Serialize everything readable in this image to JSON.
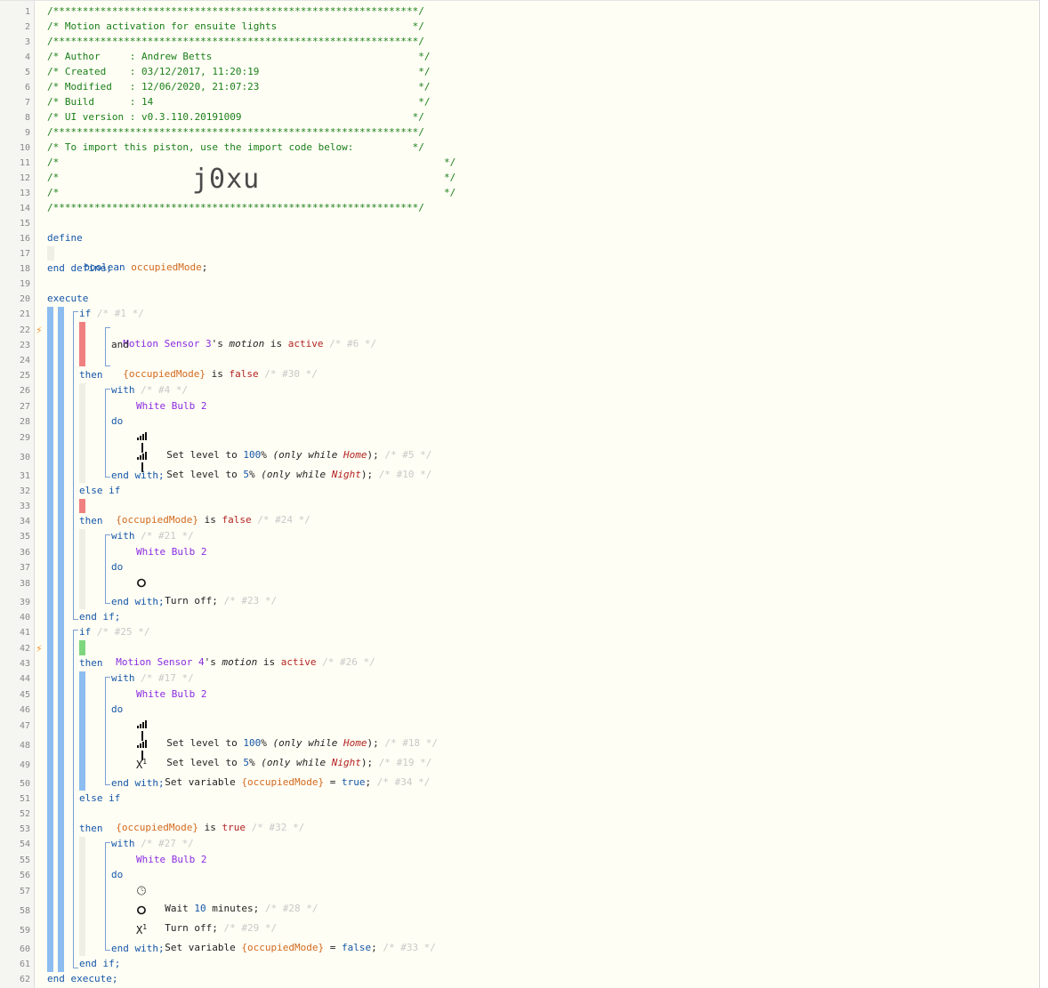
{
  "gutter": {
    "line_numbers": [
      "1",
      "2",
      "3",
      "4",
      "5",
      "6",
      "7",
      "8",
      "9",
      "10",
      "11",
      "12",
      "13",
      "14",
      "15",
      "16",
      "17",
      "18",
      "19",
      "20",
      "21",
      "22",
      "23",
      "24",
      "25",
      "26",
      "27",
      "28",
      "29",
      "30",
      "31",
      "32",
      "33",
      "34",
      "35",
      "36",
      "37",
      "38",
      "39",
      "40",
      "41",
      "42",
      "43",
      "44",
      "45",
      "46",
      "47",
      "48",
      "49",
      "50",
      "51",
      "52",
      "53",
      "54",
      "55",
      "56",
      "57",
      "58",
      "59",
      "60",
      "61",
      "62"
    ],
    "trigger_icon": "lightning-icon"
  },
  "header": {
    "stars": "/**************************************************************/",
    "stars_short": "/**************************************************************/",
    "title": "/* Motion activation for ensuite lights                       */",
    "author": "/* Author     : Andrew Betts                                   */",
    "created": "/* Created    : 03/12/2017, 11:20:19                           */",
    "modified": "/* Modified   : 12/06/2020, 21:07:23                           */",
    "build": "/* Build      : 14                                             */",
    "ui_version": "/* UI version : v0.3.110.20191009                             */",
    "import_note": "/* To import this piston, use the import code below:          */",
    "empty_left": "/*",
    "empty_right": "*/",
    "import_code": "j0xu"
  },
  "code": {
    "define": "define",
    "boolean": "boolean",
    "occupied_mode": "occupiedMode",
    "semicolon": ";",
    "end_define": "end define;",
    "execute": "execute",
    "end_execute": "end execute;",
    "if": "if",
    "then": "then",
    "else_if": "else if",
    "end_if": "end if;",
    "with": "with",
    "do": "do",
    "end_with": "end with;",
    "and": "and",
    "is": "is",
    "is_false": "is",
    "false": "false",
    "true": "true",
    "active": "active",
    "motion": "motion",
    "s_motion_3": "'s",
    "s_motion_4": "'s",
    "motion_sensor_3": "Motion Sensor 3",
    "motion_sensor_4": "Motion Sensor 4",
    "white_bulb": "White Bulb 2",
    "occupied_var": "{occupiedMode}",
    "set_level": "Set level to",
    "pct_100": "100",
    "pct_5": "5",
    "pct_sign": "%",
    "only_while_open": "(only while",
    "home": "Home",
    "night": "Night",
    "close_paren": ");",
    "turn_off": "Turn off;",
    "set_variable": "Set variable",
    "equals": "=",
    "wait": "Wait",
    "ten": "10",
    "minutes": "minutes;",
    "c1": "/* #1 */",
    "c6": "/* #6 */",
    "c30": "/* #30 */",
    "c4": "/* #4 */",
    "c5": "/* #5 */",
    "c10": "/* #10 */",
    "c24": "/* #24 */",
    "c21": "/* #21 */",
    "c23": "/* #23 */",
    "c25": "/* #25 */",
    "c26": "/* #26 */",
    "c17": "/* #17 */",
    "c18": "/* #18 */",
    "c19": "/* #19 */",
    "c34": "/* #34 */",
    "c32": "/* #32 */",
    "c27": "/* #27 */",
    "c28": "/* #28 */",
    "c29": "/* #29 */",
    "c33": "/* #33 */"
  },
  "colors": {
    "condition_false": "#f08080",
    "condition_true": "#7ed77e",
    "block_bar": "#8cbcf0",
    "comment": "#1a7f1a",
    "keyword": "#1456a8",
    "device": "#8a2be2",
    "variable": "#d2691e"
  }
}
